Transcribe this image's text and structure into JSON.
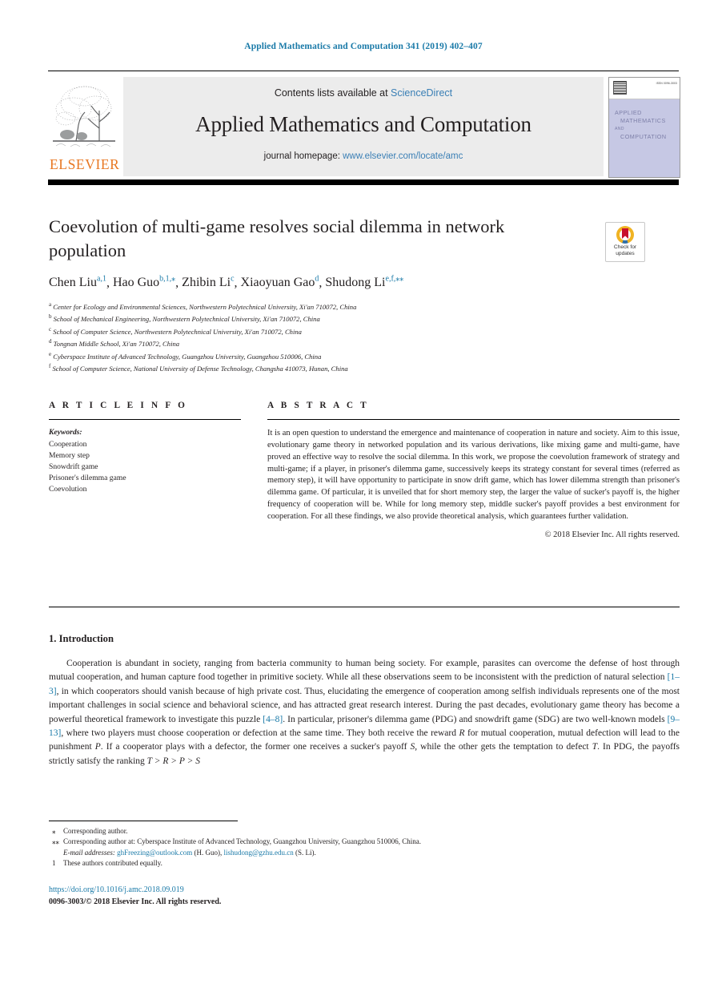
{
  "running_head": "Applied Mathematics and Computation 341 (2019) 402–407",
  "masthead": {
    "publisher": "ELSEVIER",
    "contents_prefix": "Contents lists available at ",
    "contents_link": "ScienceDirect",
    "journal_title": "Applied Mathematics and Computation",
    "homepage_prefix": "journal homepage: ",
    "homepage_url": "www.elsevier.com/locate/amc",
    "cover": {
      "line1": "APPLIED",
      "line2": "MATHEMATICS",
      "line3": "AND",
      "line4": "COMPUTATION",
      "corner_text": "ISSN 0096-3003"
    }
  },
  "article": {
    "title": "Coevolution of multi-game resolves social dilemma in network population",
    "crossmark": {
      "line1": "Check for",
      "line2": "updates"
    },
    "authors": [
      {
        "name": "Chen Liu",
        "sup": "a,1"
      },
      {
        "name": "Hao Guo",
        "sup": "b,1,",
        "star": "⁎"
      },
      {
        "name": "Zhibin Li",
        "sup": "c"
      },
      {
        "name": "Xiaoyuan Gao",
        "sup": "d"
      },
      {
        "name": "Shudong Li",
        "sup": "e,f,",
        "star": "⁎⁎"
      }
    ],
    "affiliations": [
      {
        "mark": "a",
        "text": "Center for Ecology and Environmental Sciences, Northwestern Polytechnical University, Xi'an 710072, China"
      },
      {
        "mark": "b",
        "text": "School of Mechanical Engineering, Northwestern Polytechnical University, Xi'an 710072, China"
      },
      {
        "mark": "c",
        "text": "School of Computer Science, Northwestern Polytechnical University, Xi'an 710072, China"
      },
      {
        "mark": "d",
        "text": "Tongnan Middle School, Xi'an 710072, China"
      },
      {
        "mark": "e",
        "text": "Cyberspace Institute of Advanced Technology, Guangzhou University, Guangzhou 510006, China"
      },
      {
        "mark": "f",
        "text": "School of Computer Science, National University of Defense Technology, Changsha 410073, Hunan, China"
      }
    ]
  },
  "article_info": {
    "heading": "A R T I C L E    I N F O",
    "keywords_label": "Keywords:",
    "keywords": [
      "Cooperation",
      "Memory step",
      "Snowdrift game",
      "Prisoner's dilemma game",
      "Coevolution"
    ]
  },
  "abstract": {
    "heading": "A B S T R A C T",
    "text": "It is an open question to understand the emergence and maintenance of cooperation in nature and society. Aim to this issue, evolutionary game theory in networked population and its various derivations, like mixing game and multi-game, have proved an effective way to resolve the social dilemma. In this work, we propose the coevolution framework of strategy and multi-game; if a player, in prisoner's dilemma game, successively keeps its strategy constant for several times (referred as memory step), it will have opportunity to participate in snow drift game, which has lower dilemma strength than prisoner's dilemma game. Of particular, it is unveiled that for short memory step, the larger the value of sucker's payoff is, the higher frequency of cooperation will be. While for long memory step, middle sucker's payoff provides a best environment for cooperation. For all these findings, we also provide theoretical analysis, which guarantees further validation.",
    "copyright": "© 2018 Elsevier Inc. All rights reserved."
  },
  "section": {
    "heading": "1. Introduction",
    "paragraph_parts": {
      "p1": "Cooperation is abundant in society, ranging from bacteria community to human being society. For example, parasites can overcome the defense of host through mutual cooperation, and human capture food together in primitive society. While all these observations seem to be inconsistent with the prediction of natural selection ",
      "cite1": "[1–3]",
      "p2": ", in which cooperators should vanish because of high private cost. Thus, elucidating the emergence of cooperation among selfish individuals represents one of the most important challenges in social science and behavioral science, and has attracted great research interest. During the past decades, evolutionary game theory has become a powerful theoretical framework to investigate this puzzle ",
      "cite2": "[4–8]",
      "p3": ". In particular, prisoner's dilemma game (PDG) and snowdrift game (SDG) are two well-known models ",
      "cite3": "[9–13]",
      "p4": ", where two players must choose cooperation or defection at the same time. They both receive the reward ",
      "var_R": "R",
      "p5": " for mutual cooperation, mutual defection will lead to the punishment ",
      "var_P": "P",
      "p6": ". If a cooperator plays with a defector, the former one receives a sucker's payoff ",
      "var_S": "S",
      "p7": ", while the other gets the temptation to defect ",
      "var_T": "T",
      "p8": ". In PDG, the payoffs strictly satisfy the ranking ",
      "ranking": "T > R > P > S"
    }
  },
  "footnotes": {
    "items": [
      {
        "mark": "⁎",
        "text": "Corresponding author."
      },
      {
        "mark": "⁎⁎",
        "text": "Corresponding author at: Cyberspace Institute of Advanced Technology, Guangzhou University, Guangzhou 510006, China."
      }
    ],
    "email_label": "E-mail addresses:",
    "emails": [
      {
        "address": "ghFreezing@outlook.com",
        "owner": "(H. Guo)"
      },
      {
        "address": "lishudong@gzhu.edu.cn",
        "owner": "(S. Li)"
      }
    ],
    "equal_contrib": {
      "mark": "1",
      "text": "These authors contributed equally."
    }
  },
  "footer": {
    "doi": "https://doi.org/10.1016/j.amc.2018.09.019",
    "issn_line": "0096-3003/© 2018 Elsevier Inc. All rights reserved."
  },
  "colors": {
    "link": "#1a7aa8",
    "sciencedirect": "#3a7fb5",
    "elsevier_orange": "#e87722",
    "banner_bg": "#ececec",
    "cover_bg": "#c6c8e4"
  }
}
